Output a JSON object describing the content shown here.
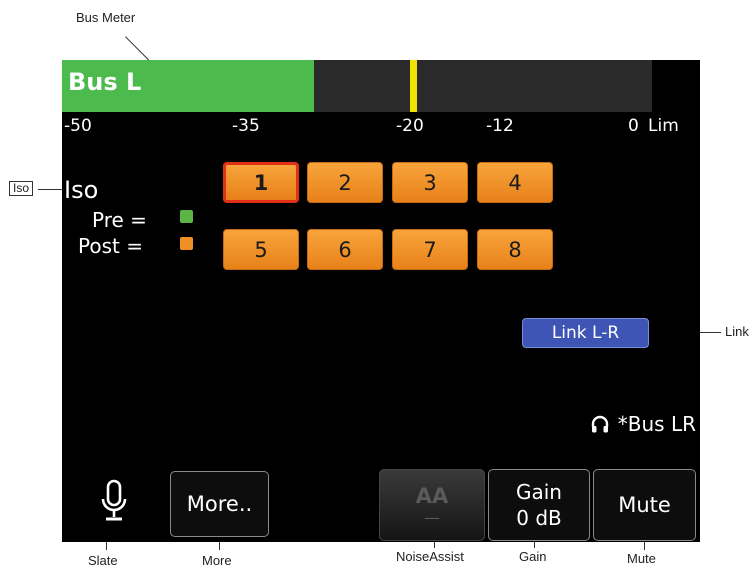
{
  "callouts": {
    "bus_meter": "Bus Meter",
    "iso": "Iso",
    "link": "Link",
    "slate": "Slate",
    "more": "More",
    "noise_assist": "NoiseAssist",
    "gain": "Gain",
    "mute": "Mute"
  },
  "meter": {
    "label": "Bus L",
    "scale": [
      "-50",
      "-35",
      "-20",
      "-12",
      "0"
    ],
    "lim_label": "Lim",
    "level_db": -28,
    "peak_db": -19
  },
  "iso": {
    "label": "Iso",
    "pre_label": "Pre =",
    "post_label": "Post =",
    "pre_color": "#5db345",
    "post_color": "#f08f26",
    "channels": [
      "1",
      "2",
      "3",
      "4",
      "5",
      "6",
      "7",
      "8"
    ],
    "selected": "1"
  },
  "link_button": "Link L-R",
  "monitor": {
    "icon": "headphones-icon",
    "label": "*Bus LR"
  },
  "softkeys": {
    "slate_icon": "microphone-icon",
    "more": "More..",
    "noise_assist": "AA",
    "noise_assist_value": "—",
    "gain_label": "Gain",
    "gain_value": "0 dB",
    "mute": "Mute"
  },
  "colors": {
    "meter_green": "#4cba4c",
    "peak_yellow": "#f2e000",
    "channel_orange": "#f08f26",
    "selected_border": "#e03018",
    "link_blue": "#3e55b6"
  }
}
